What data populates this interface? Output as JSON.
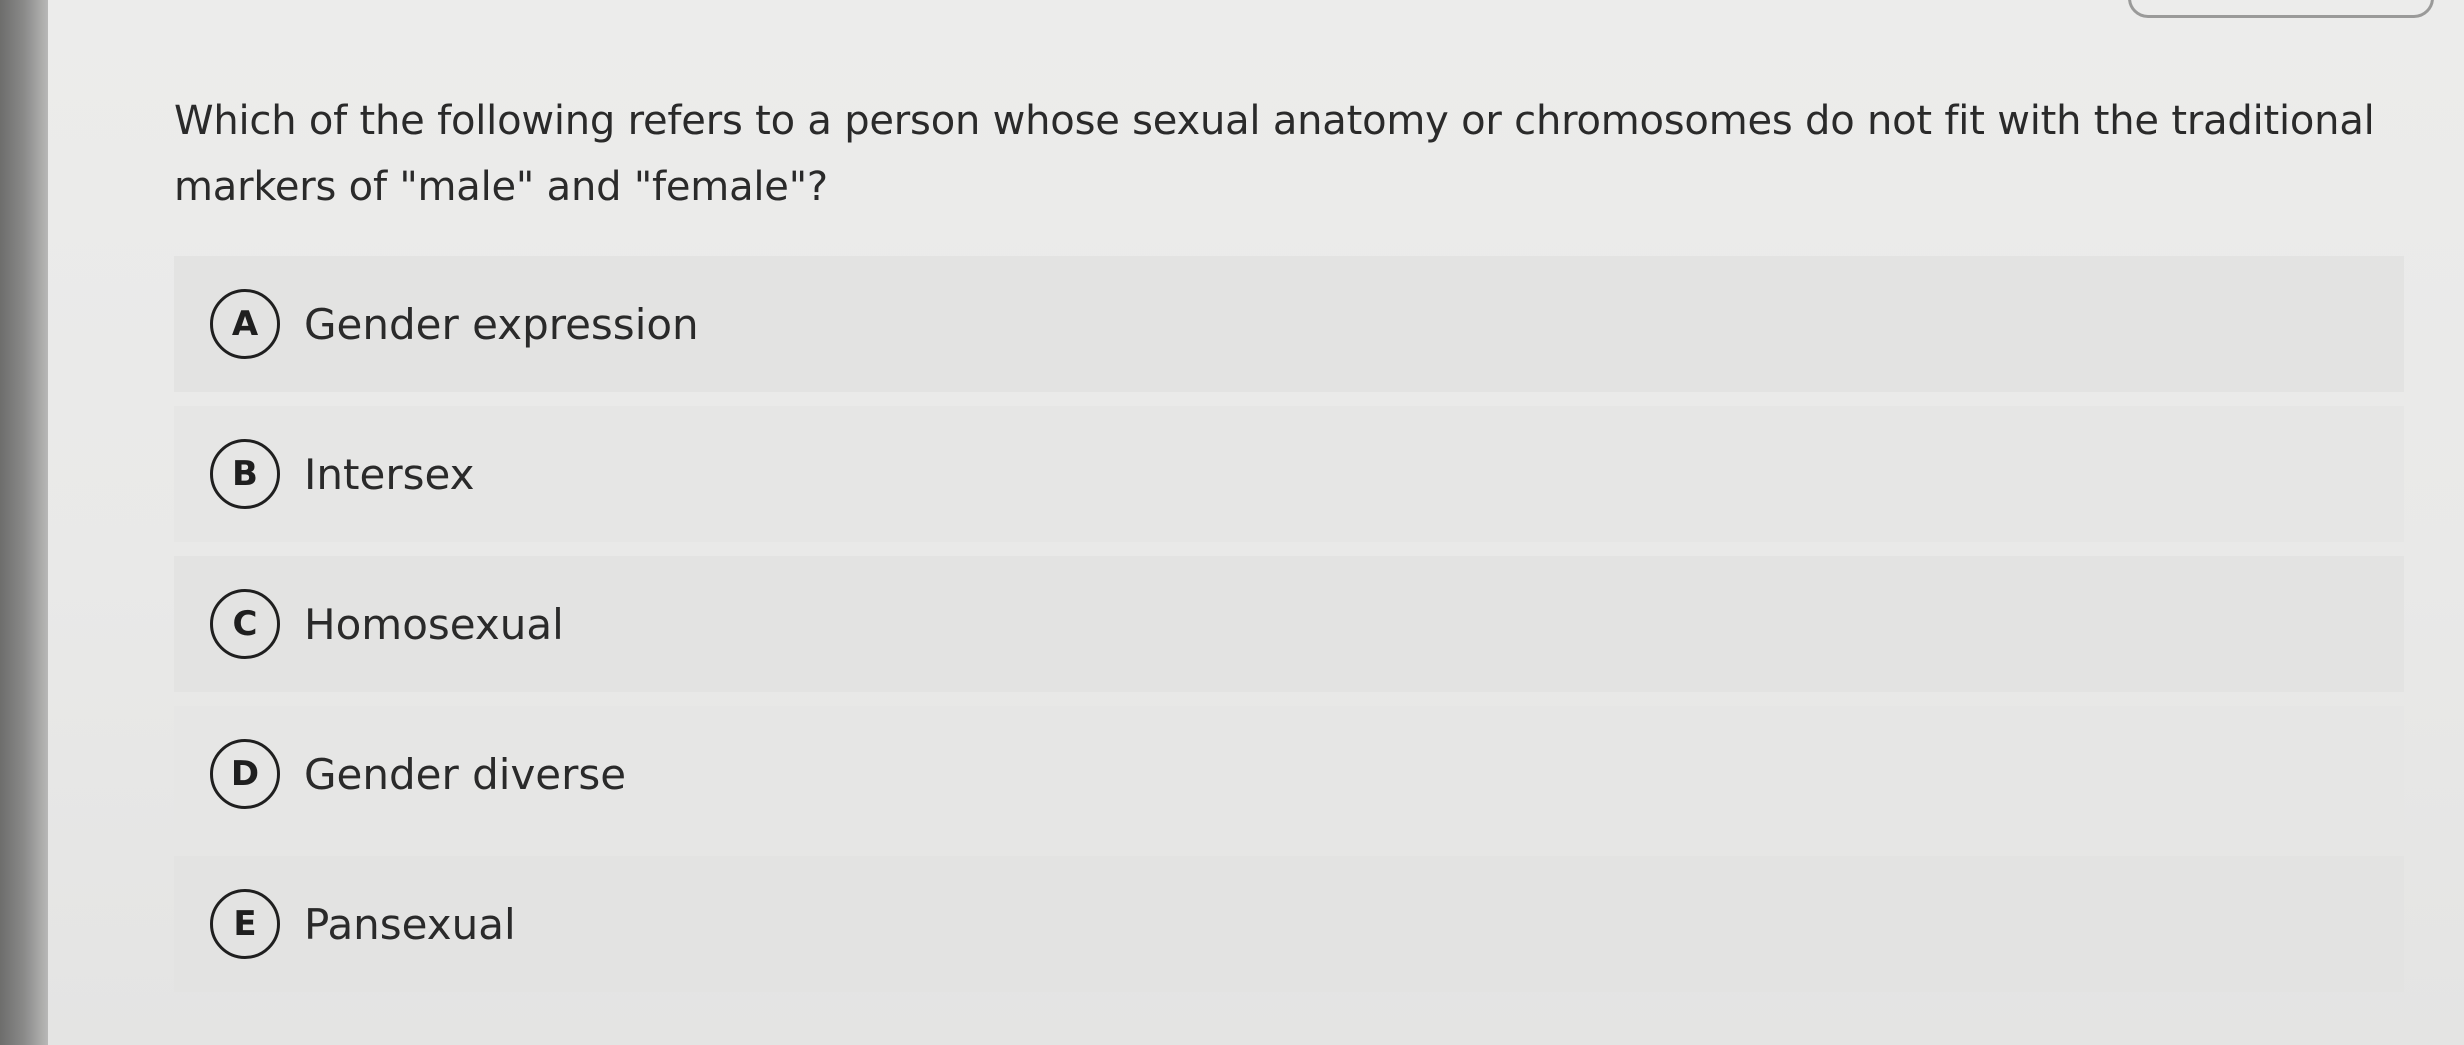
{
  "question": {
    "text": "Which of the following refers to a person whose sexual anatomy or chromosomes do not fit with the traditional markers of \"male\" and \"female\"?"
  },
  "options": [
    {
      "letter": "A",
      "label": "Gender expression"
    },
    {
      "letter": "B",
      "label": "Intersex"
    },
    {
      "letter": "C",
      "label": "Homosexual"
    },
    {
      "letter": "D",
      "label": "Gender diverse"
    },
    {
      "letter": "E",
      "label": "Pansexual"
    }
  ],
  "colors": {
    "background": "#e9e9e8",
    "option_background": "#e3e3e2",
    "text": "#2a2a2a",
    "circle_border": "#1f1f1f"
  }
}
